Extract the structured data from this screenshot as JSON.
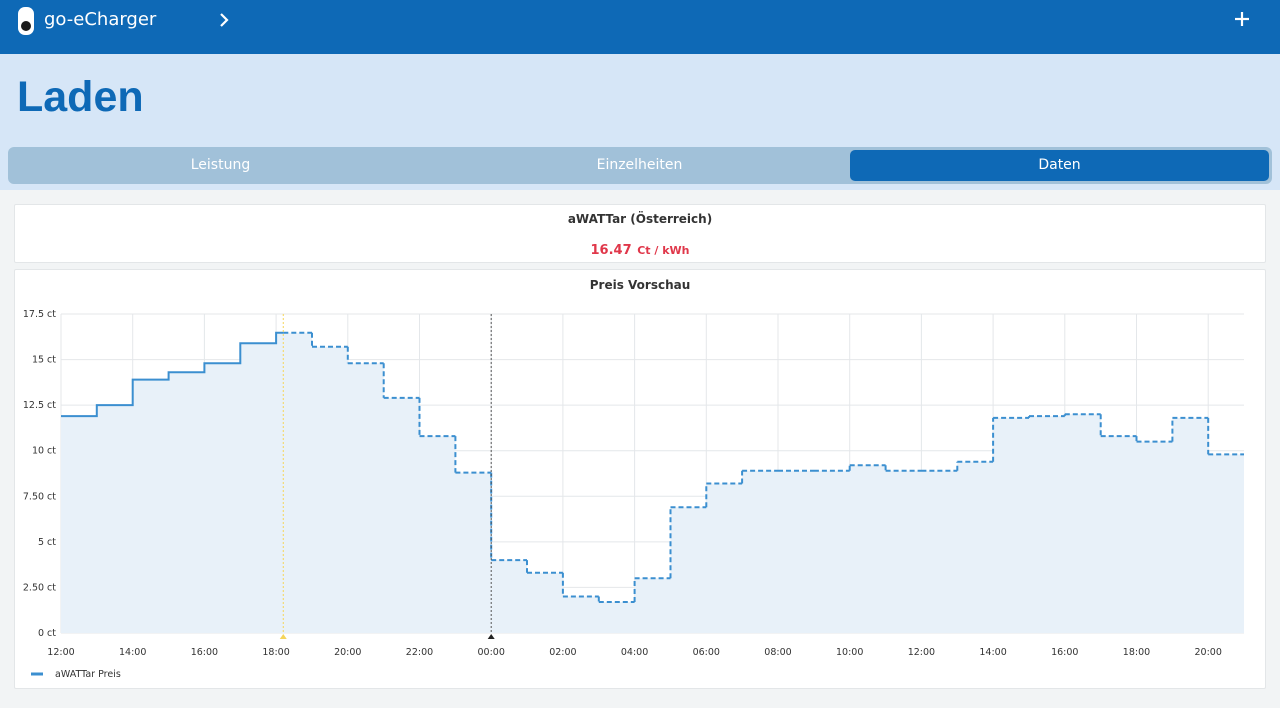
{
  "app": {
    "title": "go-eCharger"
  },
  "page": {
    "title": "Laden"
  },
  "tabs": [
    {
      "label": "Leistung",
      "active": false
    },
    {
      "label": "Einzelheiten",
      "active": false
    },
    {
      "label": "Daten",
      "active": true
    }
  ],
  "price": {
    "provider": "aWATTar (Österreich)",
    "value": "16.47",
    "unit": "Ct / kWh"
  },
  "chart_data": {
    "type": "line",
    "title": "Preis Vorschau",
    "step": true,
    "ylim": [
      0,
      17.5
    ],
    "y_ticks": [
      "0 ct",
      "2.50 ct",
      "5 ct",
      "7.50 ct",
      "10 ct",
      "12.5 ct",
      "15 ct",
      "17.5 ct"
    ],
    "x_ticks": [
      "12:00",
      "14:00",
      "16:00",
      "18:00",
      "20:00",
      "22:00",
      "00:00",
      "02:00",
      "04:00",
      "06:00",
      "08:00",
      "10:00",
      "12:00",
      "14:00",
      "16:00",
      "18:00",
      "20:00"
    ],
    "x_range_hours": [
      12,
      45
    ],
    "current_time_hours": 18.2,
    "now_marker_hours": 24,
    "legend": "aWATTar Preis",
    "colors": {
      "line": "#3b8fd0",
      "fill": "#e8f1f9",
      "current": "#f5d55b"
    },
    "series": [
      {
        "name": "aWATTar Preis",
        "values": [
          11.9,
          12.5,
          13.9,
          14.3,
          14.8,
          15.9,
          16.47,
          15.7,
          14.8,
          12.9,
          10.8,
          8.8,
          4.0,
          3.3,
          2.0,
          1.7,
          3.0,
          6.9,
          8.2,
          8.9,
          8.9,
          8.9,
          9.2,
          8.9,
          8.9,
          9.4,
          11.8,
          11.9,
          12.0,
          10.8,
          10.5,
          11.8,
          9.8
        ]
      }
    ]
  }
}
